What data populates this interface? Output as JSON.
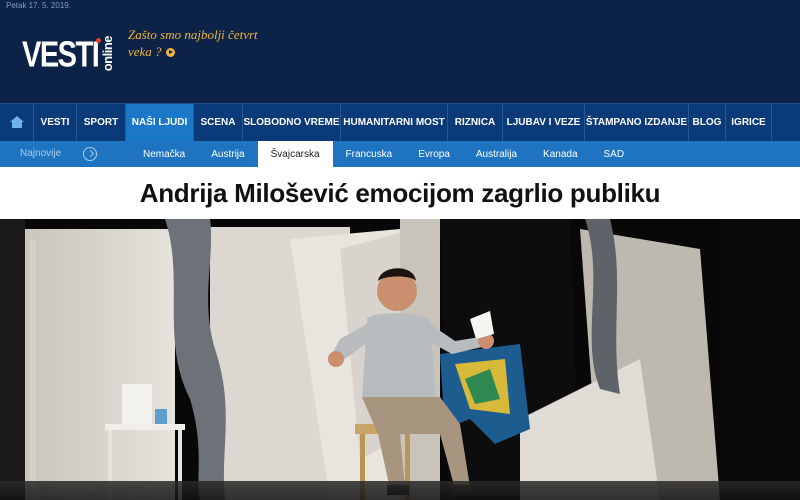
{
  "header": {
    "date": "Petak 17. 5. 2019.",
    "logo_main": "VESTI",
    "logo_sub": "online",
    "tagline": "Zašto smo najbolji četvrt veka ?"
  },
  "nav": {
    "items": [
      {
        "label": "VESTI",
        "active": false
      },
      {
        "label": "SPORT",
        "active": false
      },
      {
        "label": "NAŠI LJUDI",
        "active": true
      },
      {
        "label": "SCENA",
        "active": false
      },
      {
        "label": "SLOBODNO VREME",
        "active": false
      },
      {
        "label": "HUMANITARNI MOST",
        "active": false
      },
      {
        "label": "RIZNICA",
        "active": false
      },
      {
        "label": "LJUBAV I VEZE",
        "active": false
      },
      {
        "label": "ŠTAMPANO IZDANJE",
        "active": false
      },
      {
        "label": "BLOG",
        "active": false
      },
      {
        "label": "IGRICE",
        "active": false
      }
    ]
  },
  "subnav": {
    "latest_label": "Najnovije",
    "items": [
      {
        "label": "Nemačka",
        "active": false
      },
      {
        "label": "Austrija",
        "active": false
      },
      {
        "label": "Švajcarska",
        "active": true
      },
      {
        "label": "Francuska",
        "active": false
      },
      {
        "label": "Evropa",
        "active": false
      },
      {
        "label": "Australija",
        "active": false
      },
      {
        "label": "Kanada",
        "active": false
      },
      {
        "label": "SAD",
        "active": false
      }
    ]
  },
  "article": {
    "title": "Andrija Milošević emocijom zagrlio publiku"
  },
  "colors": {
    "header_bg": "#0c2347",
    "nav_bg": "#0a3a78",
    "nav_active": "#1b78c9",
    "subnav_bg": "#1f74c1",
    "tagline": "#f0b43a"
  }
}
